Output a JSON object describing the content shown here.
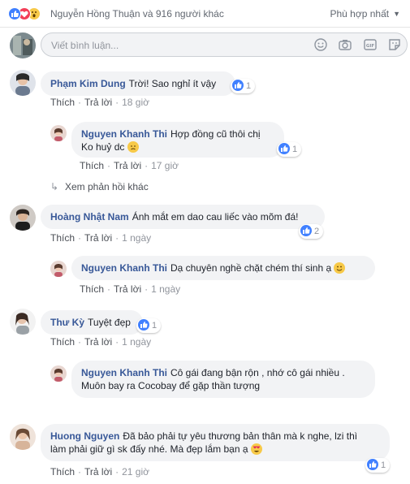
{
  "summary": {
    "text": "Nguyễn Hồng Thuận và 916 người khác",
    "sort_label": "Phù hợp nhất"
  },
  "composer": {
    "placeholder": "Viết bình luận..."
  },
  "comments": [
    {
      "name": "Phạm Kim Dung",
      "text": "Trời! Sao nghỉ ít vậy",
      "like": "Thích",
      "reply": "Trả lời",
      "time": "18 giờ",
      "likes": "1",
      "replies": [
        {
          "name": "Nguyen Khanh Thi",
          "text_line1": "Hợp đồng cũ thôi chị",
          "text_line2": "Ko huỷ dc",
          "like": "Thích",
          "reply": "Trả lời",
          "time": "17 giờ",
          "likes": "1"
        }
      ],
      "more_replies": "Xem phản hồi khác"
    },
    {
      "name": "Hoàng Nhật Nam",
      "text": "Ánh mắt em dao cau liếc vào mõm đá!",
      "like": "Thích",
      "reply": "Trả lời",
      "time": "1 ngày",
      "likes": "2",
      "replies": [
        {
          "name": "Nguyen Khanh Thi",
          "text": "Dạ chuyên nghề chặt chém thí sinh ạ",
          "like": "Thích",
          "reply": "Trả lời",
          "time": "1 ngày"
        }
      ]
    },
    {
      "name": "Thư Kỳ",
      "text": "Tuyệt đẹp",
      "like": "Thích",
      "reply": "Trả lời",
      "time": "1 ngày",
      "likes": "1",
      "replies": [
        {
          "name": "Nguyen Khanh Thi",
          "text_line1": "Cô gái đang bận rộn , nhớ cô gái nhiều .",
          "text_line2": "Muôn bay ra Cocobay để gặp thần tượng"
        }
      ]
    },
    {
      "name": "Huong Nguyen",
      "text_line1": "Đã bảo phải tự yêu thương bản thân mà k nghe, lzi thì",
      "text_line2": "làm phải giữ gì sk đấy nhé. Mà đẹp lắm bạn ạ",
      "like": "Thích",
      "reply": "Trả lời",
      "time": "21 giờ",
      "likes": "1"
    }
  ],
  "colors": {
    "name_link": "#385898",
    "bubble_bg": "#f2f3f5",
    "like_blue": "#4080ff",
    "meta_gray": "#90949c"
  }
}
